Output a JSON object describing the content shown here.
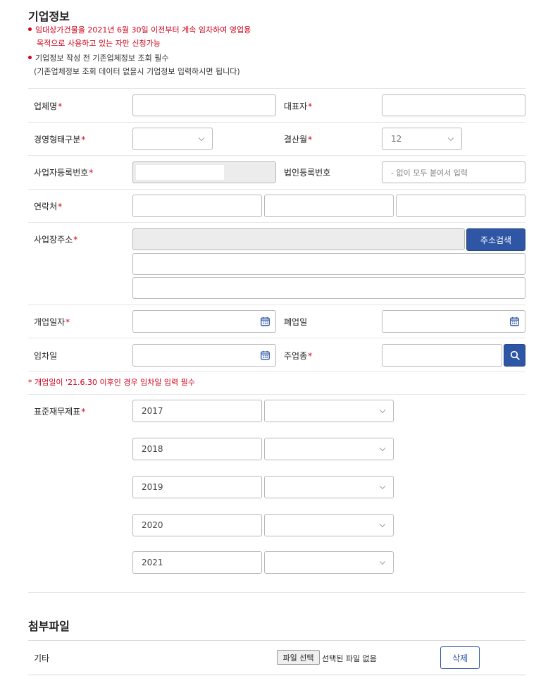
{
  "company": {
    "title": "기업정보",
    "notes": {
      "n1_line1": "임대상가건물을 2021년 6월 30일 이전부터 계속 임차하여 영업용",
      "n1_line2": "목적으로 사용하고 있는 자만 신청가능",
      "n2_line1": "기업정보 작성 전 기존업체정보 조회 필수",
      "n2_line2": "(기존업체정보 조회 데이터 없을시 기업정보 입력하시면 됩니다)"
    },
    "required_mark": "*",
    "fields": {
      "company_name": "업체명",
      "ceo": "대표자",
      "biz_type": "경영형태구분",
      "settle_month": "결산월",
      "settle_month_value": "12",
      "biz_reg_no": "사업자등록번호",
      "corp_reg_no": "법인등록번호",
      "corp_reg_no_placeholder": "- 없이 모두 붙여서 입력",
      "contact": "연락처",
      "address": "사업장주소",
      "address_search": "주소검색",
      "open_date": "개업일자",
      "close_date": "폐업일",
      "lease_date": "임차일",
      "main_industry": "주업종"
    },
    "warning": "* 개업일이 '21.6.30 이후인 경우 임차일 입력 필수",
    "financial": {
      "label": "표준재무제표",
      "years": [
        "2017",
        "2018",
        "2019",
        "2020",
        "2021"
      ]
    }
  },
  "attach": {
    "title": "첨부파일",
    "row_label": "기타",
    "file_button": "파일 선택",
    "no_file": "선택된 파일 없음",
    "delete": "삭제"
  },
  "icons": {
    "calendar": "calendar-icon",
    "search": "search-icon",
    "chevron": "chevron-down-icon"
  },
  "colors": {
    "accent": "#2f56a5",
    "required": "#d0021b"
  }
}
